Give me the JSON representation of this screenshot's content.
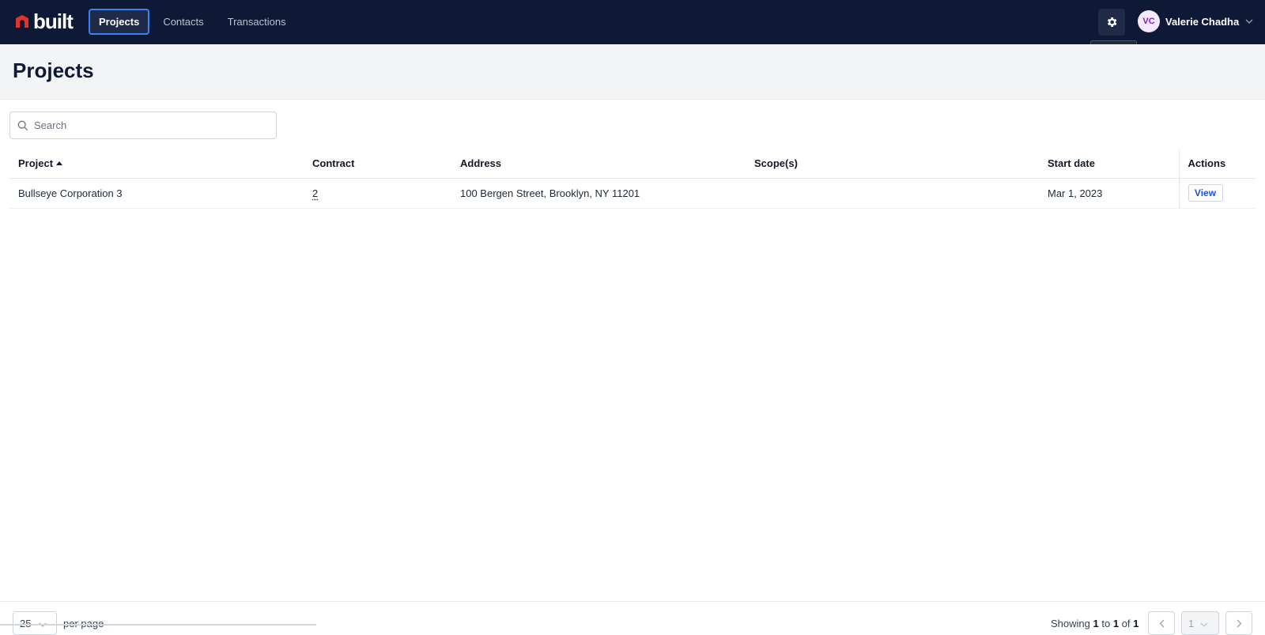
{
  "app": {
    "logo_text": "built"
  },
  "nav": {
    "items": [
      {
        "label": "Projects",
        "active": true
      },
      {
        "label": "Contacts",
        "active": false
      },
      {
        "label": "Transactions",
        "active": false
      }
    ]
  },
  "header_right": {
    "settings_tooltip": "Settings",
    "user": {
      "initials": "VC",
      "name": "Valerie Chadha"
    }
  },
  "page": {
    "title": "Projects"
  },
  "search": {
    "placeholder": "Search",
    "value": ""
  },
  "table": {
    "columns": [
      "Project",
      "Contract",
      "Address",
      "Scope(s)",
      "Start date",
      "Actions"
    ],
    "sorted_column": "Project",
    "rows": [
      {
        "project": "Bullseye Corporation 3",
        "contract": "2",
        "address": "100 Bergen Street, Brooklyn, NY 11201",
        "scopes": "",
        "start_date": "Mar 1, 2023",
        "action_label": "View"
      }
    ]
  },
  "pagination": {
    "per_page": "25",
    "per_page_label": "per page",
    "showing_prefix": "Showing",
    "from": "1",
    "to_word": "to",
    "to": "1",
    "of_word": "of",
    "total": "1",
    "current_page": "1"
  },
  "colors": {
    "topbar": "#0e1a35",
    "accent": "#3b82f6",
    "logo_red": "#e0312b",
    "link_blue": "#1d4ed8"
  },
  "icons": [
    "logo-mark-icon",
    "gear-icon",
    "chevron-down-icon",
    "search-icon",
    "sort-up-icon",
    "chevron-left-icon",
    "chevron-right-icon"
  ]
}
